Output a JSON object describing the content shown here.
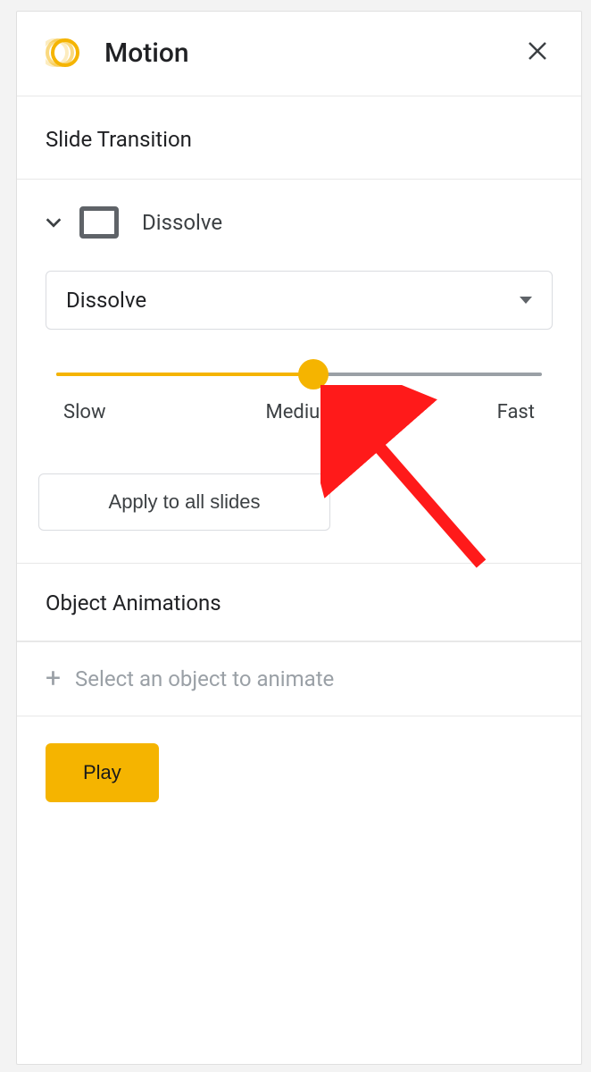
{
  "header": {
    "title": "Motion"
  },
  "slideTransition": {
    "sectionTitle": "Slide Transition",
    "currentName": "Dissolve",
    "dropdownValue": "Dissolve",
    "speed": {
      "slow": "Slow",
      "medium": "Medium",
      "fast": "Fast",
      "valuePercent": 53
    },
    "applyAllLabel": "Apply to all slides"
  },
  "objectAnimations": {
    "sectionTitle": "Object Animations",
    "placeholder": "Select an object to animate"
  },
  "playButton": "Play"
}
